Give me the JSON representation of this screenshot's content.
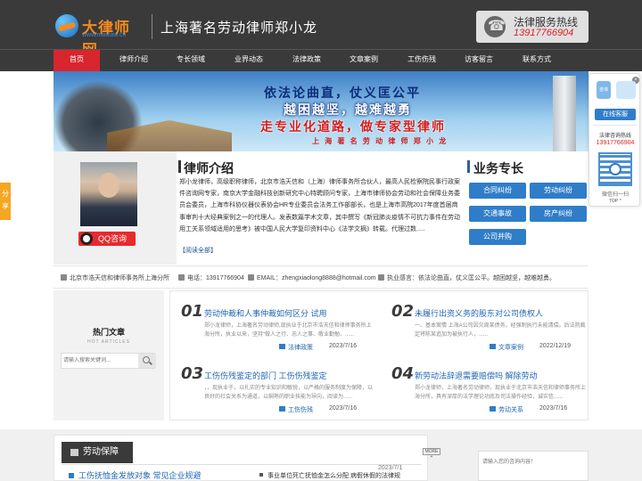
{
  "header": {
    "logo_text": "大律师网",
    "logo_url": "www.maxlaw.cn",
    "slogan": "上海著名劳动律师郑小龙",
    "hotline_label": "法律服务热线",
    "hotline_number": "13917766904"
  },
  "nav": {
    "items": [
      {
        "label": "首页"
      },
      {
        "label": "律师介绍"
      },
      {
        "label": "专长领域"
      },
      {
        "label": "业界动态"
      },
      {
        "label": "法律政策"
      },
      {
        "label": "文章案例"
      },
      {
        "label": "工伤伤残"
      },
      {
        "label": "访客留言"
      },
      {
        "label": "联系方式"
      }
    ]
  },
  "banner": {
    "line1": "依法论曲直，仗义匡公平",
    "line2": "越困越坚，越难越勇",
    "line3": "走专业化道路，做专家型律师",
    "line4": "上 海 著 名 劳 动 律 师 郑 小 龙"
  },
  "about": {
    "qq_label": "QQ咨询",
    "title": "律师介绍",
    "text": "郑小龙律师，高级职称律师，北京市浩天信和（上海）律师事务所合伙人，最高人民检察院民事行政案件咨询网专家，南京大学金融科技创新研究中心特聘顾问专家，上海市律师协会劳动和社会保障业务委员会委员，上海市科协仪器仪表协会HR专业委员会法务工作部部长，也是上海市高院2017年度首届商事审判十大经典案例之一的代理人。发表数篇学术文章，其中撰写《新冠肺炎疫情不可抗力事件在劳动用工关系领域适用的思考》被中国人民大学复印资料中心《法学文摘》转载。代理过数.....",
    "read_all": "【阅读全部】",
    "spec_title": "业务专长",
    "specialties": [
      "合同纠纷",
      "劳动纠纷",
      "交通事故",
      "房产纠纷",
      "公司并购"
    ]
  },
  "contact": {
    "firm": "北京市浩天信和律师事务所上海分所",
    "phone": "电话：13917766904",
    "email": "EMAIL：zhengxiaolong8888@hotmail.com",
    "motto": "执业感言：依法论曲直，仗义匡公平。越困越坚，越难越勇。"
  },
  "hot": {
    "title": "热门文章",
    "subtitle": "HOT ARTICLES",
    "search_placeholder": "请输入搜索关键词..."
  },
  "articles": [
    {
      "num": "01",
      "title": "劳动仲裁和人事仲裁如何区分 试用",
      "summary": "郑小龙律师，上海著名劳动律师,现执业于北京市浩天信和律师事务所上海分所，执业以来，坚持“做人之行、忠人之事、敬业勤勉、......",
      "category": "法律政策",
      "date": "2023/7/16"
    },
    {
      "num": "02",
      "title": "未履行出资义务的股东对公司债权人",
      "summary": "一、基本案情 上海A公司因欠周某债务，经强制执行未能清偿。后法院裁定将陈某追加为被执行人，......",
      "category": "文章案例",
      "date": "2022/12/19"
    },
    {
      "num": "03",
      "title": "工伤伤残鉴定的部门 工伤伤残鉴定",
      "summary": "，，现执业于，以扎实的专业知识和敏锐，以严格的服务制度为保障，以良好的社会关系为通道，以娴熟的职业技能为导向，阅读为......",
      "category": "工伤伤残",
      "date": "2023/7/16"
    },
    {
      "num": "04",
      "title": "新劳动法辞退需要赔偿吗 解除劳动",
      "summary": "郑小龙律师，上海著名劳动律师，现执业于北京市浩天信和律师事务所上海分所，具有深厚的法学理论功底及司法操作经验，诚实信......",
      "category": "劳动关系",
      "date": "2023/7/16"
    }
  ],
  "lower": {
    "tab_label": "劳动保障",
    "more": "MORE +",
    "link1": "工伤抚恤金发放对象 常见企业规避",
    "link2": "事业单位死亡抚恤金怎么分配 病假休假的法律规",
    "date2": "2023/7/1",
    "msg_placeholder": "请输入您的咨询内容！"
  },
  "share": {
    "label": "分享"
  },
  "float_service": {
    "consult": "咨询",
    "online": "在线客服",
    "label": "法律咨询热线",
    "phone": "13917766904",
    "wechat": "微信扫一扫",
    "top": "TOP ^"
  },
  "colors": {
    "header_bg": "#3a3a3a",
    "accent_red": "#d7262d",
    "accent_blue": "#2f7dc8",
    "logo_orange": "#f68a1e"
  }
}
